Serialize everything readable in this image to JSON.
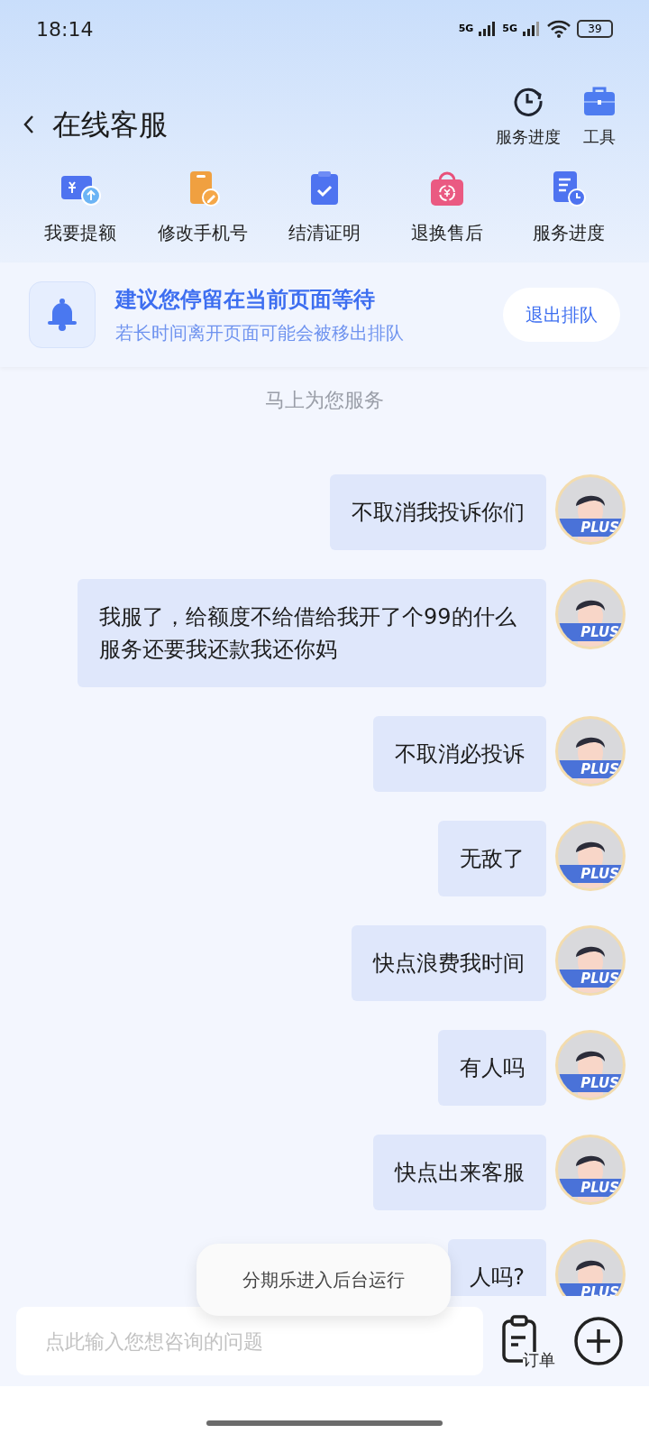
{
  "status_bar": {
    "time": "18:14",
    "network_1": "5G",
    "network_2": "5G",
    "battery": "39"
  },
  "header": {
    "title": "在线客服",
    "actions": [
      {
        "label": "服务进度",
        "kind": "clock"
      },
      {
        "label": "工具",
        "kind": "toolbox"
      }
    ]
  },
  "shortcuts": [
    {
      "label": "我要提额",
      "kind": "wallet"
    },
    {
      "label": "修改手机号",
      "kind": "phone"
    },
    {
      "label": "结清证明",
      "kind": "clipboard"
    },
    {
      "label": "退换售后",
      "kind": "bag"
    },
    {
      "label": "服务进度",
      "kind": "doc"
    }
  ],
  "banner": {
    "title": "建议您停留在当前页面等待",
    "subtitle": "若长时间离开页面可能会被移出排队",
    "button": "退出排队"
  },
  "system_note": "马上为您服务",
  "messages": [
    {
      "text": "不取消我投诉你们",
      "badge": "PLUS"
    },
    {
      "text": "我服了，给额度不给借给我开了个99的什么服务还要我还款我还你妈",
      "badge": "PLUS"
    },
    {
      "text": "不取消必投诉",
      "badge": "PLUS"
    },
    {
      "text": "无敌了",
      "badge": "PLUS"
    },
    {
      "text": "快点浪费我时间",
      "badge": "PLUS"
    },
    {
      "text": "有人吗",
      "badge": "PLUS"
    },
    {
      "text": "快点出来客服",
      "badge": "PLUS"
    },
    {
      "text": "人吗?",
      "badge": "PLUS"
    }
  ],
  "toast": "分期乐进入后台运行",
  "input": {
    "placeholder": "点此输入您想咨询的问题",
    "order_button": "订单"
  }
}
